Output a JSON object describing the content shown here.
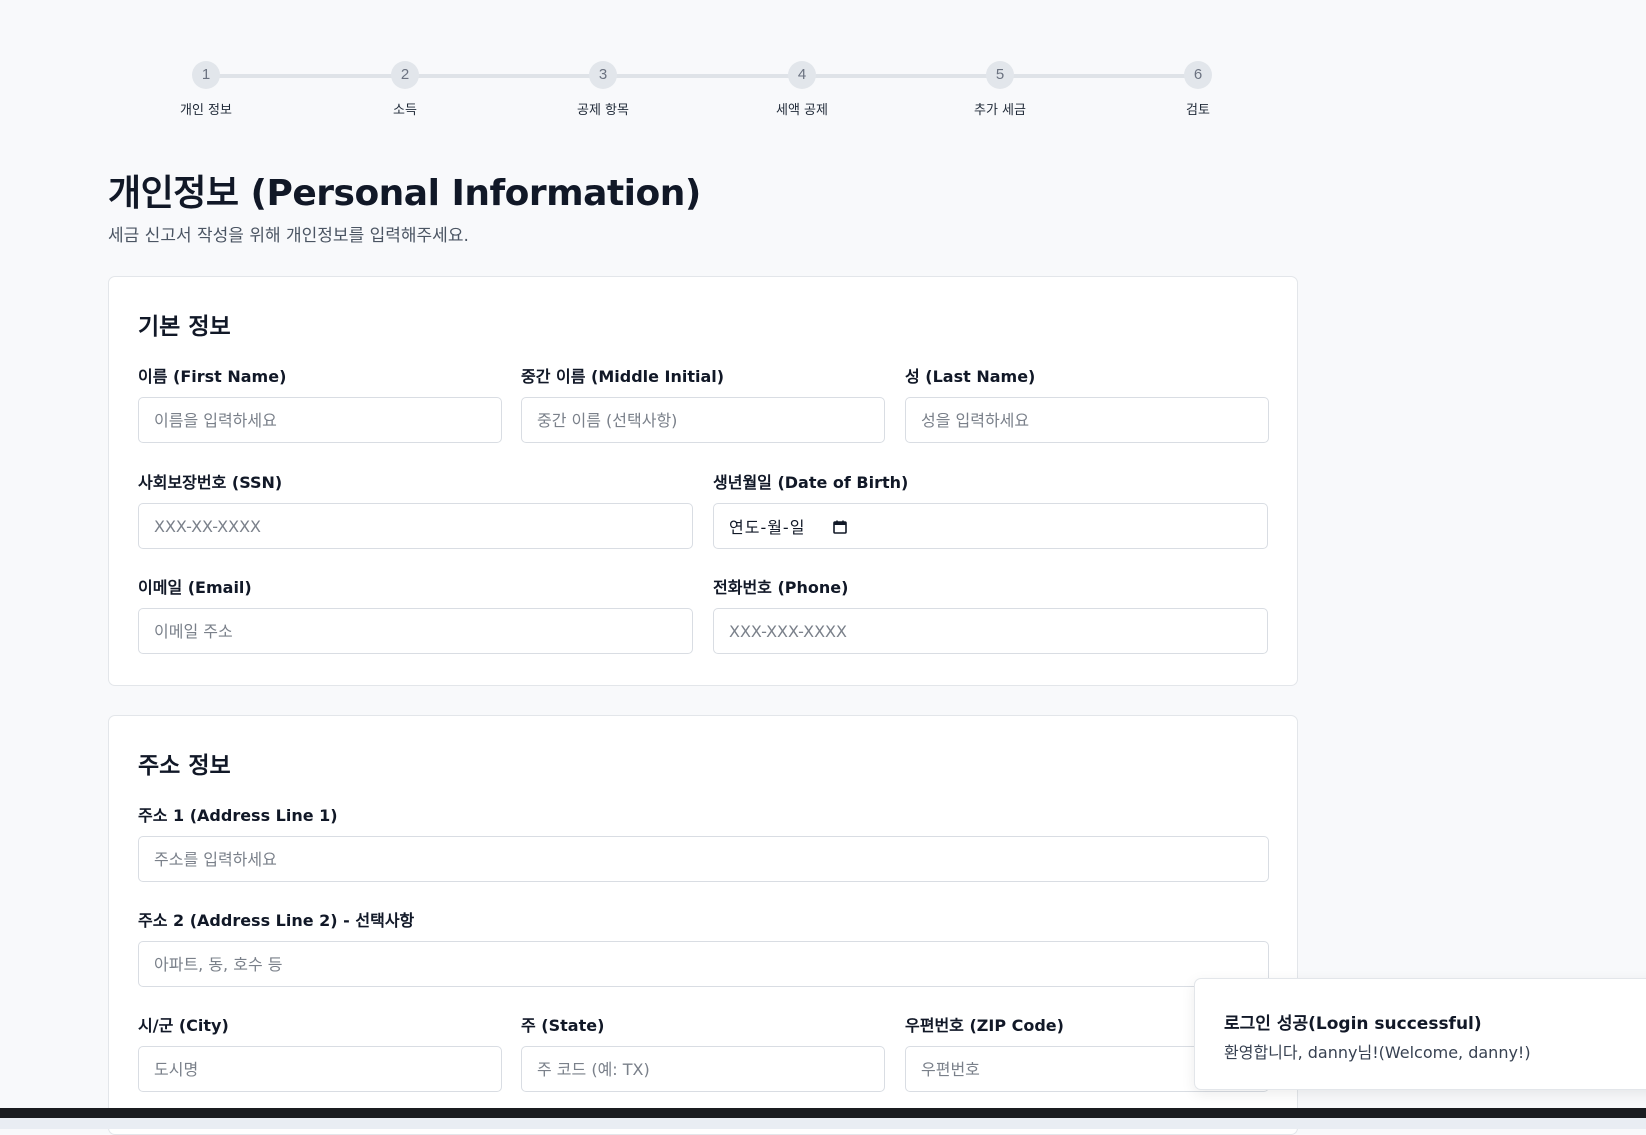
{
  "stepper": {
    "steps": [
      {
        "number": "1",
        "label": "개인 정보"
      },
      {
        "number": "2",
        "label": "소득"
      },
      {
        "number": "3",
        "label": "공제 항목"
      },
      {
        "number": "4",
        "label": "세액 공제"
      },
      {
        "number": "5",
        "label": "추가 세금"
      },
      {
        "number": "6",
        "label": "검토"
      }
    ]
  },
  "page": {
    "title": "개인정보 (Personal Information)",
    "subtitle": "세금 신고서 작성을 위해 개인정보를 입력해주세요."
  },
  "basic_info": {
    "title": "기본 정보",
    "first_name": {
      "label": "이름 (First Name)",
      "placeholder": "이름을 입력하세요"
    },
    "middle_initial": {
      "label": "중간 이름 (Middle Initial)",
      "placeholder": "중간 이름 (선택사항)"
    },
    "last_name": {
      "label": "성 (Last Name)",
      "placeholder": "성을 입력하세요"
    },
    "ssn": {
      "label": "사회보장번호 (SSN)",
      "placeholder": "XXX-XX-XXXX"
    },
    "dob": {
      "label": "생년월일 (Date of Birth)",
      "value": "연도-월-일"
    },
    "email": {
      "label": "이메일 (Email)",
      "placeholder": "이메일 주소"
    },
    "phone": {
      "label": "전화번호 (Phone)",
      "placeholder": "XXX-XXX-XXXX"
    }
  },
  "address_info": {
    "title": "주소 정보",
    "address1": {
      "label": "주소 1 (Address Line 1)",
      "placeholder": "주소를 입력하세요"
    },
    "address2": {
      "label": "주소 2 (Address Line 2) - 선택사항",
      "placeholder": "아파트, 동, 호수 등"
    },
    "city": {
      "label": "시/군 (City)",
      "placeholder": "도시명"
    },
    "state": {
      "label": "주 (State)",
      "placeholder": "주 코드 (예: TX)"
    },
    "zip": {
      "label": "우편번호 (ZIP Code)",
      "placeholder": "우편번호"
    }
  },
  "toast": {
    "title": "로그인 성공(Login successful)",
    "message": "환영합니다, danny님!(Welcome, danny!)"
  },
  "colors": {
    "background": "#f8f9fb",
    "card": "#ffffff",
    "border": "#d9dde3",
    "step_inactive": "#e2e6eb",
    "text_primary": "#111827",
    "text_secondary": "#4b5563"
  }
}
